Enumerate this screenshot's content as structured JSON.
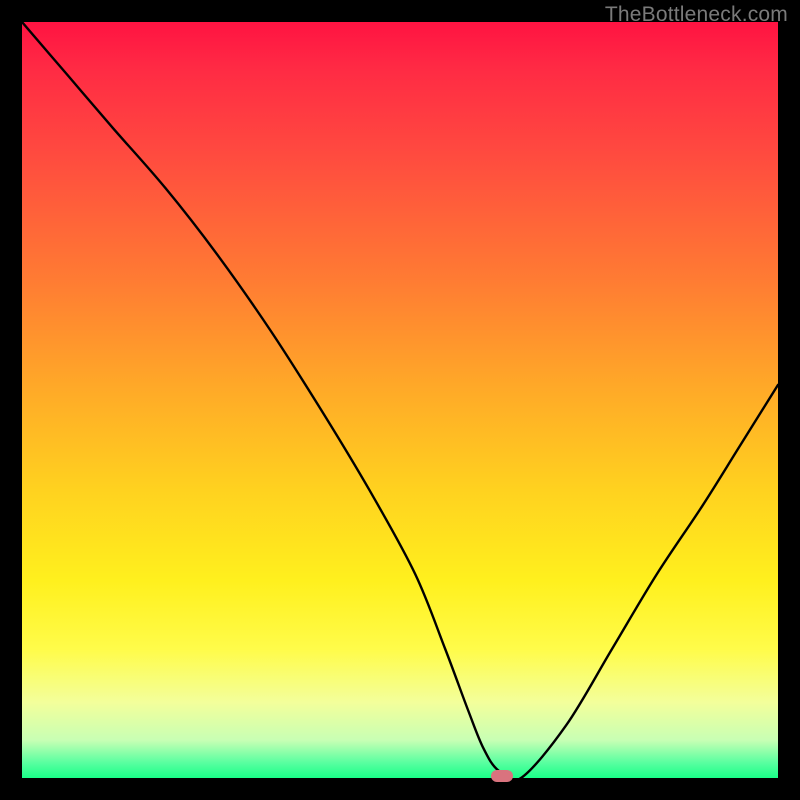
{
  "watermark": "TheBottleneck.com",
  "chart_data": {
    "type": "line",
    "title": "",
    "xlabel": "",
    "ylabel": "",
    "xlim": [
      0,
      100
    ],
    "ylim": [
      0,
      100
    ],
    "x": [
      0,
      6,
      12,
      19,
      26,
      33,
      40,
      46,
      52,
      56,
      59,
      61,
      63,
      66,
      72,
      78,
      84,
      90,
      95,
      100
    ],
    "values": [
      100,
      93,
      86,
      78,
      69,
      59,
      48,
      38,
      27,
      17,
      9,
      4,
      1,
      0,
      7,
      17,
      27,
      36,
      44,
      52
    ],
    "marker": {
      "x": 63.5,
      "y": 0
    },
    "gradient_stops": [
      {
        "pos": 0,
        "color": "#ff1342"
      },
      {
        "pos": 18,
        "color": "#ff4c3f"
      },
      {
        "pos": 48,
        "color": "#ffa828"
      },
      {
        "pos": 74,
        "color": "#fff01e"
      },
      {
        "pos": 95,
        "color": "#c8ffb4"
      },
      {
        "pos": 100,
        "color": "#1aff88"
      }
    ]
  }
}
